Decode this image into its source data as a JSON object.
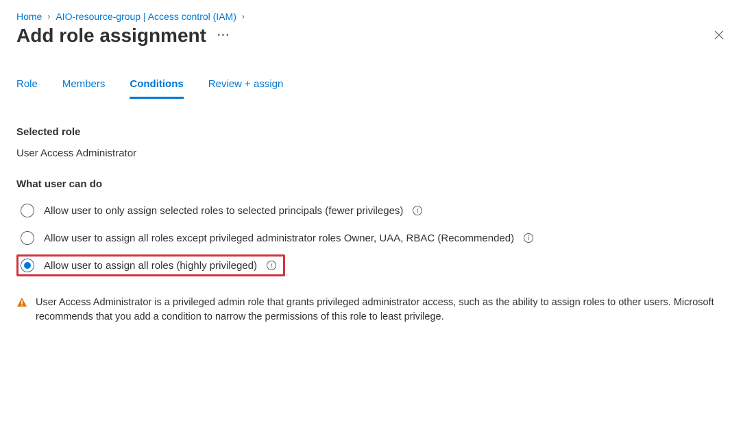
{
  "breadcrumb": {
    "home": "Home",
    "resource": "AIO-resource-group | Access control (IAM)"
  },
  "header": {
    "title": "Add role assignment"
  },
  "tabs": {
    "role": "Role",
    "members": "Members",
    "conditions": "Conditions",
    "review": "Review + assign"
  },
  "selected_role": {
    "label": "Selected role",
    "value": "User Access Administrator"
  },
  "what_user_can_do": {
    "label": "What user can do",
    "options": [
      "Allow user to only assign selected roles to selected principals (fewer privileges)",
      "Allow user to assign all roles except privileged administrator roles Owner, UAA, RBAC (Recommended)",
      "Allow user to assign all roles (highly privileged)"
    ],
    "selected_index": 2
  },
  "warning": {
    "text": "User Access Administrator is a privileged admin role that grants privileged administrator access, such as the ability to assign roles to other users. Microsoft recommends that you add a condition to narrow the permissions of this role to least privilege."
  }
}
